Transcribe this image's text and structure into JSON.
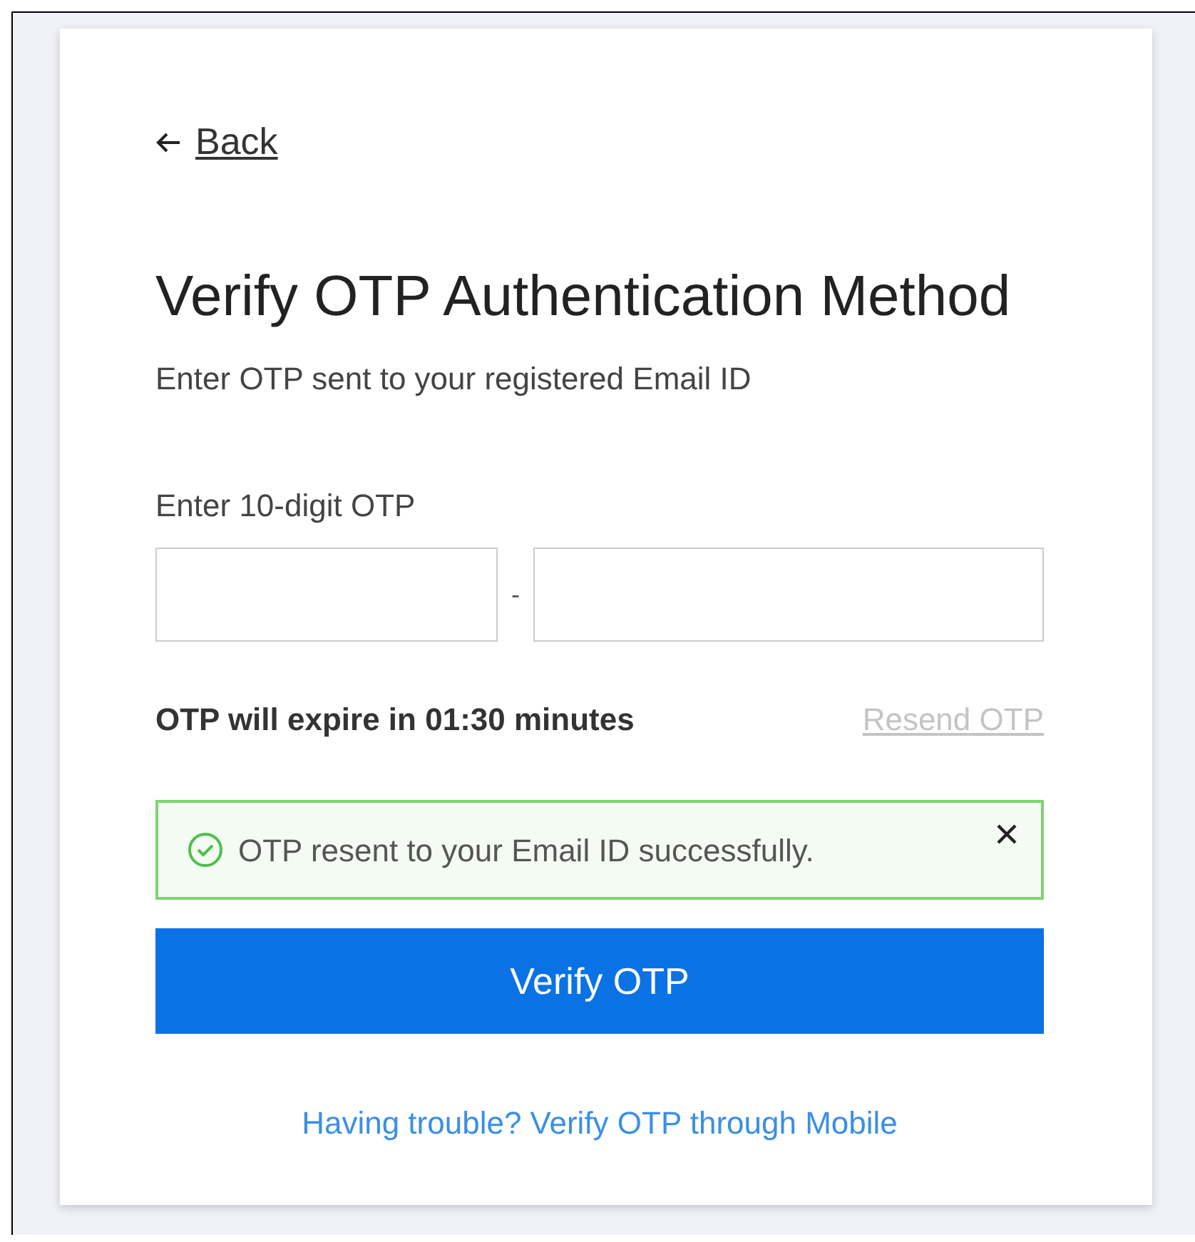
{
  "back_link": {
    "label": "Back"
  },
  "title": "Verify OTP Authentication Method",
  "subtitle": "Enter OTP sent to your registered Email ID",
  "otp": {
    "label": "Enter 10-digit OTP",
    "separator": "-"
  },
  "expiry": {
    "text": "OTP will expire in 01:30 minutes"
  },
  "resend": {
    "label": "Resend OTP",
    "disabled": true
  },
  "alert": {
    "kind": "success",
    "message": "OTP resent to your Email ID successfully.",
    "dismissible": true
  },
  "verify_button": {
    "label": "Verify OTP"
  },
  "help_link": {
    "label": "Having trouble? Verify OTP through Mobile"
  }
}
